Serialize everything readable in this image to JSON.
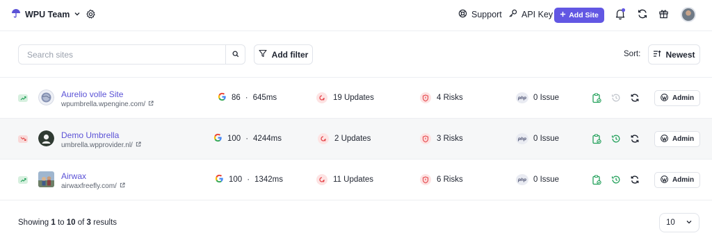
{
  "header": {
    "team_name": "WPU Team",
    "support_label": "Support",
    "api_key_label": "API Key",
    "add_site_label": "Add Site",
    "accent_color": "#6257e3",
    "notification_dot_color": "#6257e3"
  },
  "toolbar": {
    "search_placeholder": "Search sites",
    "search_value": "",
    "add_filter_label": "Add filter",
    "sort_label": "Sort:",
    "sort_value": "Newest"
  },
  "sites": [
    {
      "trend": "up",
      "name": "Aurelio volle Site",
      "url": "wpumbrella.wpengine.com/",
      "avatar_icon": "globe-avatar",
      "performance_score": "86",
      "separator": "·",
      "response_time": "645ms",
      "updates": "19 Updates",
      "risks": "4 Risks",
      "issues": "0 Issue",
      "history_status": "inactive",
      "admin_label": "Admin"
    },
    {
      "trend": "down",
      "name": "Demo Umbrella",
      "url": "umbrella.wpprovider.nl/",
      "avatar_icon": "person-avatar",
      "performance_score": "100",
      "separator": "·",
      "response_time": "4244ms",
      "updates": "2 Updates",
      "risks": "3 Risks",
      "issues": "0 Issue",
      "history_status": "active",
      "admin_label": "Admin"
    },
    {
      "trend": "up",
      "name": "Airwax",
      "url": "airwaxfreefly.com/",
      "avatar_icon": "photo-avatar",
      "performance_score": "100",
      "separator": "·",
      "response_time": "1342ms",
      "updates": "11 Updates",
      "risks": "6 Risks",
      "issues": "0 Issue",
      "history_status": "active",
      "admin_label": "Admin"
    }
  ],
  "footer": {
    "showing_prefix": "Showing",
    "from": "1",
    "to_word": "to",
    "to": "10",
    "of_word": "of",
    "total": "3",
    "results_word": "results",
    "per_page": "10"
  },
  "colors": {
    "trend_up": "#22a05a",
    "trend_down": "#e04848",
    "updates_icon": "#e5484d",
    "risks_icon": "#e5484d",
    "success_green": "#22a05a",
    "inactive_gray": "#c2c6cd"
  },
  "labels": {
    "php": "php"
  }
}
